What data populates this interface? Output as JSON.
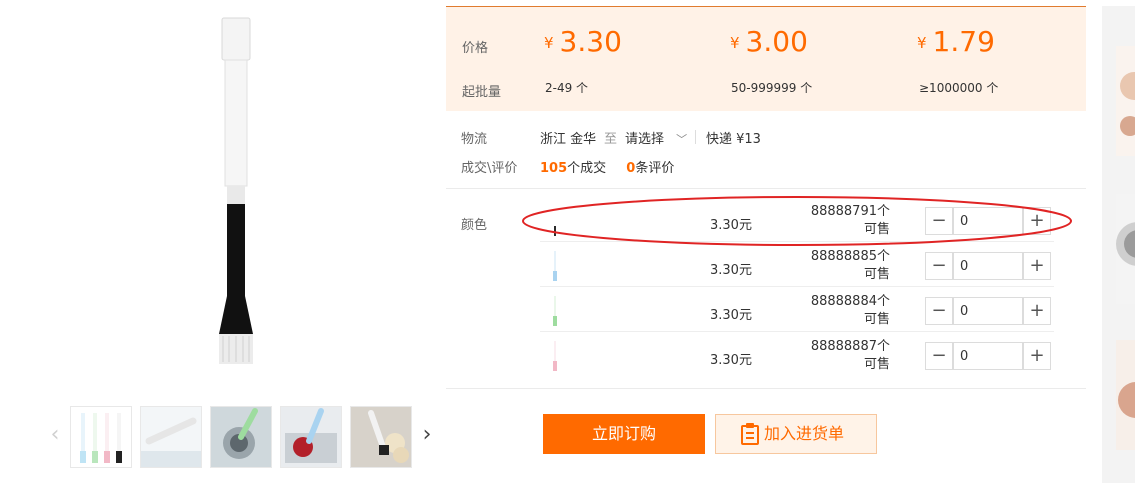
{
  "price_panel": {
    "price_label": "价格",
    "moq_label": "起批量",
    "currency": "¥",
    "tiers": [
      {
        "price": "3.30",
        "range": "2-49 个"
      },
      {
        "price": "3.00",
        "range": "50-999999 个"
      },
      {
        "price": "1.79",
        "range": "≥1000000 个"
      }
    ]
  },
  "logistics": {
    "label": "物流",
    "origin": "浙江 金华",
    "to": "至",
    "destination": "请选择",
    "shipping": "快递 ¥13"
  },
  "deals": {
    "label": "成交\\评价",
    "deal_count": "105",
    "deal_suffix": "个成交",
    "review_count": "0",
    "review_suffix": "条评价"
  },
  "sku": {
    "label": "颜色",
    "rows": [
      {
        "price": "3.30元",
        "stock": "88888791个可售",
        "qty": "0",
        "color": "#2b2b2b"
      },
      {
        "price": "3.30元",
        "stock": "88888885个可售",
        "qty": "0",
        "color": "#a9d3f0"
      },
      {
        "price": "3.30元",
        "stock": "88888884个可售",
        "qty": "0",
        "color": "#9edc9f"
      },
      {
        "price": "3.30元",
        "stock": "88888887个可售",
        "qty": "0",
        "color": "#f2b8c6"
      }
    ]
  },
  "actions": {
    "order": "立即订购",
    "cart": "加入进货单"
  },
  "colors": {
    "accent": "#ff6a00",
    "panel_bg": "#fff2e7",
    "annotation": "#e02424"
  }
}
